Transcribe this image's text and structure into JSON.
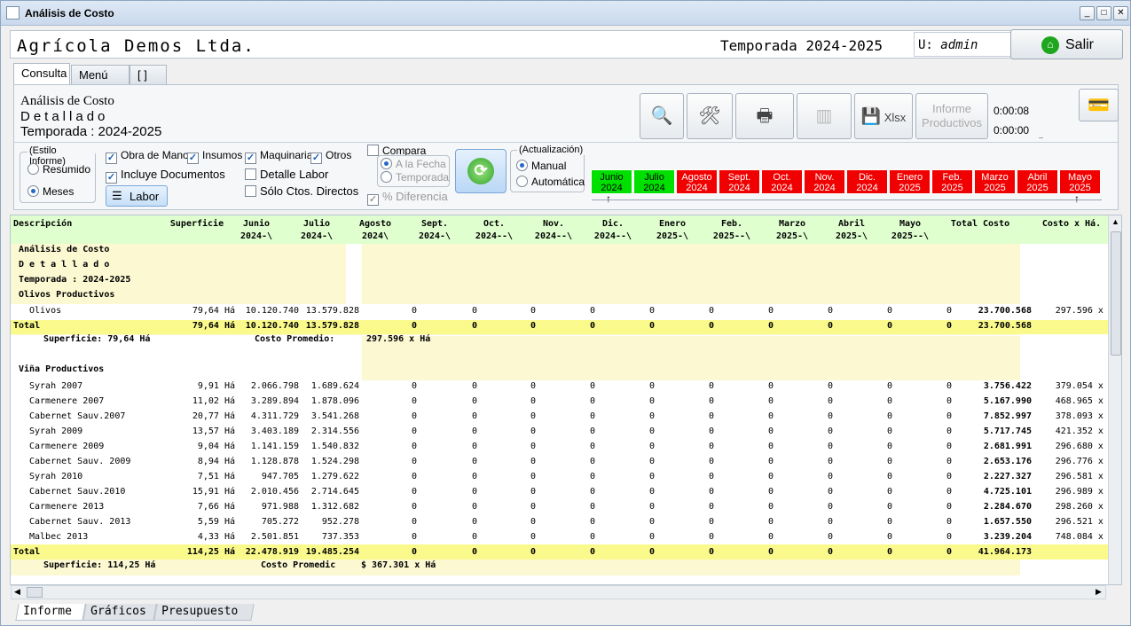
{
  "window": {
    "title": "Análisis de Costo"
  },
  "header": {
    "company": "Agrícola Demos Ltda.",
    "season": "Temporada 2024-2025",
    "user_label": "U:",
    "user": "admin",
    "exit_label": "Salir"
  },
  "tabs": [
    "Consulta",
    "Menú",
    "[   ]"
  ],
  "report": {
    "title": "Análisis de Costo",
    "subtitle": "Detallado",
    "season": "Temporada : 2024-2025"
  },
  "toolbar": {
    "xlsx_label": "Xlsx",
    "informe_label": "Informe Productivos",
    "timer1": "0:00:08",
    "timer2": "0:00:00",
    "dots": ".."
  },
  "estilo": {
    "label": "(Estilo Informe)",
    "resumido": "Resumido",
    "meses": "Meses",
    "selected": "Meses"
  },
  "filters": {
    "obra": "Obra de Mano",
    "insumos": "Insumos",
    "maquinaria": "Maquinaria",
    "otros": "Otros",
    "incluye_docs": "Incluye Documentos",
    "detalle_labor": "Detalle Labor",
    "solo_directos": "Sólo Ctos. Directos",
    "labor_btn": "Labor"
  },
  "compara": {
    "label": "Compara",
    "a_la_fecha": "A la Fecha",
    "temporada": "Temporada",
    "diferencia": "% Diferencia"
  },
  "actualizacion": {
    "label": "(Actualización)",
    "manual": "Manual",
    "automatica": "Automática",
    "selected": "Manual"
  },
  "months": [
    {
      "m": "Junio",
      "y": "2024",
      "status": "green"
    },
    {
      "m": "Julio",
      "y": "2024",
      "status": "green"
    },
    {
      "m": "Agosto",
      "y": "2024",
      "status": "red"
    },
    {
      "m": "Sept.",
      "y": "2024",
      "status": "red"
    },
    {
      "m": "Oct.",
      "y": "2024",
      "status": "red"
    },
    {
      "m": "Nov.",
      "y": "2024",
      "status": "red"
    },
    {
      "m": "Dic.",
      "y": "2024",
      "status": "red"
    },
    {
      "m": "Enero",
      "y": "2025",
      "status": "red"
    },
    {
      "m": "Feb.",
      "y": "2025",
      "status": "red"
    },
    {
      "m": "Marzo",
      "y": "2025",
      "status": "red"
    },
    {
      "m": "Abril",
      "y": "2025",
      "status": "red"
    },
    {
      "m": "Mayo",
      "y": "2025",
      "status": "red"
    }
  ],
  "table": {
    "headers": [
      [
        "Descripción",
        ""
      ],
      [
        "Superficie",
        ""
      ],
      [
        "Junio",
        "2024-\\"
      ],
      [
        "Julio",
        "2024-\\"
      ],
      [
        "Agosto",
        "2024\\"
      ],
      [
        "Sept.",
        "2024-\\"
      ],
      [
        "Oct.",
        "2024--\\"
      ],
      [
        "Nov.",
        "2024--\\"
      ],
      [
        "Dic.",
        "2024--\\"
      ],
      [
        "Enero",
        "2025-\\"
      ],
      [
        "Feb.",
        "2025--\\"
      ],
      [
        "Marzo",
        "2025-\\"
      ],
      [
        "Abril",
        "2025-\\"
      ],
      [
        "Mayo",
        "2025--\\"
      ],
      [
        "Total Costo",
        ""
      ],
      [
        "Costo x Há.",
        ""
      ]
    ],
    "block_title": [
      "Análisis de Costo",
      "D e t a l l a d o",
      "Temporada : 2024-2025"
    ],
    "group1": {
      "name": "Olivos Productivos",
      "rows": [
        [
          "Olivos",
          "79,64 Há",
          "10.120.740",
          "13.579.828",
          "0",
          "0",
          "0",
          "0",
          "0",
          "0",
          "0",
          "0",
          "0",
          "0",
          "23.700.568",
          "297.596 x Há"
        ]
      ],
      "total": [
        "Total",
        "79,64 Há",
        "10.120.740",
        "13.579.828",
        "0",
        "0",
        "0",
        "0",
        "0",
        "0",
        "0",
        "0",
        "0",
        "0",
        "23.700.568",
        ""
      ],
      "sup": "Superficie: 79,64 Há",
      "prom_label": "Costo Promedio:",
      "prom_value": "297.596 x Há"
    },
    "group2": {
      "name": "Viña Productivos",
      "rows": [
        [
          "Syrah 2007",
          "9,91 Há",
          "2.066.798",
          "1.689.624",
          "0",
          "0",
          "0",
          "0",
          "0",
          "0",
          "0",
          "0",
          "0",
          "0",
          "3.756.422",
          "379.054 x Há"
        ],
        [
          "Carmenere 2007",
          "11,02 Há",
          "3.289.894",
          "1.878.096",
          "0",
          "0",
          "0",
          "0",
          "0",
          "0",
          "0",
          "0",
          "0",
          "0",
          "5.167.990",
          "468.965 x Há"
        ],
        [
          "Cabernet Sauv.2007",
          "20,77 Há",
          "4.311.729",
          "3.541.268",
          "0",
          "0",
          "0",
          "0",
          "0",
          "0",
          "0",
          "0",
          "0",
          "0",
          "7.852.997",
          "378.093 x Há"
        ],
        [
          "Syrah 2009",
          "13,57 Há",
          "3.403.189",
          "2.314.556",
          "0",
          "0",
          "0",
          "0",
          "0",
          "0",
          "0",
          "0",
          "0",
          "0",
          "5.717.745",
          "421.352 x Há"
        ],
        [
          "Carmenere 2009",
          "9,04 Há",
          "1.141.159",
          "1.540.832",
          "0",
          "0",
          "0",
          "0",
          "0",
          "0",
          "0",
          "0",
          "0",
          "0",
          "2.681.991",
          "296.680 x Há"
        ],
        [
          "Cabernet Sauv. 2009",
          "8,94 Há",
          "1.128.878",
          "1.524.298",
          "0",
          "0",
          "0",
          "0",
          "0",
          "0",
          "0",
          "0",
          "0",
          "0",
          "2.653.176",
          "296.776 x Há"
        ],
        [
          "Syrah 2010",
          "7,51 Há",
          "947.705",
          "1.279.622",
          "0",
          "0",
          "0",
          "0",
          "0",
          "0",
          "0",
          "0",
          "0",
          "0",
          "2.227.327",
          "296.581 x Há"
        ],
        [
          "Cabernet Sauv.2010",
          "15,91 Há",
          "2.010.456",
          "2.714.645",
          "0",
          "0",
          "0",
          "0",
          "0",
          "0",
          "0",
          "0",
          "0",
          "0",
          "4.725.101",
          "296.989 x Há"
        ],
        [
          "Carmenere 2013",
          "7,66 Há",
          "971.988",
          "1.312.682",
          "0",
          "0",
          "0",
          "0",
          "0",
          "0",
          "0",
          "0",
          "0",
          "0",
          "2.284.670",
          "298.260 x Há"
        ],
        [
          "Cabernet Sauv. 2013",
          "5,59 Há",
          "705.272",
          "952.278",
          "0",
          "0",
          "0",
          "0",
          "0",
          "0",
          "0",
          "0",
          "0",
          "0",
          "1.657.550",
          "296.521 x Há"
        ],
        [
          "Malbec 2013",
          "4,33 Há",
          "2.501.851",
          "737.353",
          "0",
          "0",
          "0",
          "0",
          "0",
          "0",
          "0",
          "0",
          "0",
          "0",
          "3.239.204",
          "748.084 x Há"
        ]
      ],
      "total": [
        "Total",
        "114,25 Há",
        "22.478.919",
        "19.485.254",
        "0",
        "0",
        "0",
        "0",
        "0",
        "0",
        "0",
        "0",
        "0",
        "0",
        "41.964.173",
        ""
      ],
      "sup": "Superficie: 114,25 Há",
      "prom_label": "Costo Promedic",
      "prom_value": "$ 367.301 x Há"
    }
  },
  "bottom_tabs": [
    "Informe",
    "Gráficos",
    "Presupuesto"
  ]
}
